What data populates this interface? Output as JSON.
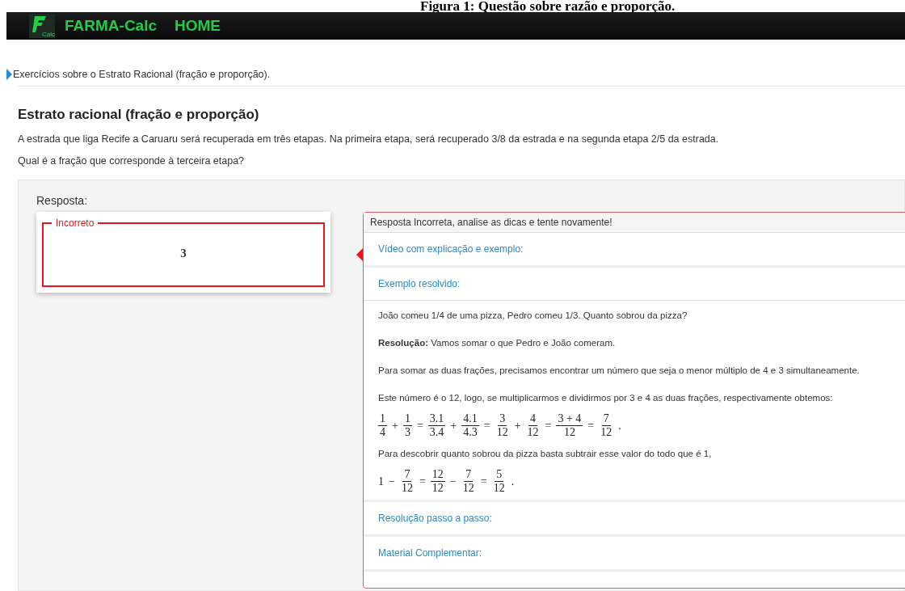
{
  "figure_caption": "Figura 1: Questão sobre razão e proporção.",
  "navbar": {
    "logo_caption": "Calc",
    "brand": "FARMA-Calc",
    "link": "HOME"
  },
  "breadcrumb": "Exercícios sobre o Estrato Racional (fração e proporção).",
  "title": "Estrato racional (fração e proporção)",
  "question": [
    "A estrada que liga Recife a Caruaru será recuperada em três etapas. Na primeira etapa, será recuperado 3/8 da estrada e na segunda etapa 2/5 da estrada.",
    "Qual é a fração que corresponde à terceira etapa?"
  ],
  "answer": {
    "label": "Resposta:",
    "status": "Incorreto",
    "correct": false,
    "value": "3"
  },
  "feedback": {
    "message": "Resposta Incorreta, analise as dicas e tente novamente!",
    "sections": [
      {
        "title": "Vídeo com explicação e exemplo:",
        "expanded": false
      },
      {
        "title": "Exemplo resolvido:",
        "expanded": true,
        "content": [
          {
            "kind": "text",
            "text": "João comeu 1/4 de uma pizza, Pedro comeu 1/3. Quanto sobrou da pizza?"
          },
          {
            "kind": "text",
            "text": "**Resolução:** Vamos somar o que Pedro e João comeram."
          },
          {
            "kind": "text",
            "text": "Para somar as duas frações, precisamos encontrar um número que seja o menor múltiplo de 4 e 3 simultaneamente."
          },
          {
            "kind": "text",
            "text": "Este número é o 12, logo, se multiplicarmos e dividirmos por 3 e 4 as duas frações, respectivamente obtemos:"
          },
          {
            "kind": "equation",
            "terms": [
              {
                "kind": "frac",
                "num": "1",
                "den": "4"
              },
              {
                "kind": "op",
                "text": "+"
              },
              {
                "kind": "frac",
                "num": "1",
                "den": "3"
              },
              {
                "kind": "op",
                "text": "="
              },
              {
                "kind": "frac",
                "num": "3.1",
                "den": "3.4"
              },
              {
                "kind": "op",
                "text": "+"
              },
              {
                "kind": "frac",
                "num": "4.1",
                "den": "4.3"
              },
              {
                "kind": "op",
                "text": "="
              },
              {
                "kind": "frac",
                "num": "3",
                "den": "12"
              },
              {
                "kind": "op",
                "text": "+"
              },
              {
                "kind": "frac",
                "num": "4",
                "den": "12"
              },
              {
                "kind": "op",
                "text": "="
              },
              {
                "kind": "frac",
                "num": "3 + 4",
                "den": "12"
              },
              {
                "kind": "op",
                "text": "="
              },
              {
                "kind": "frac",
                "num": "7",
                "den": "12"
              },
              {
                "kind": "op",
                "text": "."
              }
            ]
          },
          {
            "kind": "text",
            "text": "Para descobrir quanto sobrou da pizza basta subtrair esse valor do todo que é 1,"
          },
          {
            "kind": "equation",
            "terms": [
              {
                "kind": "op",
                "text": "1"
              },
              {
                "kind": "op",
                "text": "−"
              },
              {
                "kind": "frac",
                "num": "7",
                "den": "12"
              },
              {
                "kind": "op",
                "text": "="
              },
              {
                "kind": "frac",
                "num": "12",
                "den": "12"
              },
              {
                "kind": "op",
                "text": "−"
              },
              {
                "kind": "frac",
                "num": "7",
                "den": "12"
              },
              {
                "kind": "op",
                "text": "="
              },
              {
                "kind": "frac",
                "num": "5",
                "den": "12"
              },
              {
                "kind": "op",
                "text": "."
              }
            ]
          }
        ]
      },
      {
        "title": "Resolução passo a passo:",
        "expanded": false
      },
      {
        "title": "Material Complementar:",
        "expanded": false
      }
    ]
  }
}
